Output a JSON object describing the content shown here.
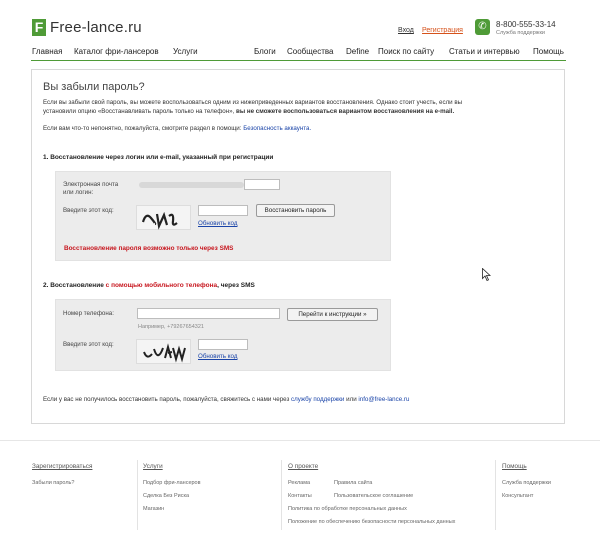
{
  "header": {
    "logo_letter": "F",
    "logo_text": "Free-lance.ru",
    "login": "Вход",
    "register": "Регистрация",
    "phone": "8-800-555-33-14",
    "phone_sub": "Служба поддержки"
  },
  "nav": {
    "left": [
      "Главная",
      "Каталог фри-лансеров",
      "Услуги"
    ],
    "right": [
      "Блоги",
      "Сообщества",
      "Define",
      "Поиск по сайту",
      "Статьи и интервью",
      "Помощь"
    ]
  },
  "page": {
    "title": "Вы забыли пароль?",
    "intro_line1": "Если вы забыли свой пароль, вы можете воспользоваться одним из нижеприведенных вариантов восстановления. Однако стоит учесть, если вы",
    "intro_line2_plain": "установили опцию «Восстанавливать пароль только на телефон»,",
    "intro_line2_bold": "вы не сможете воспользоваться вариантом восстановления на e-mail.",
    "help_text": "Если вам что-то непонятно, пожалуйста, смотрите раздел в помощи:",
    "help_link": "Безопасность аккаунта.",
    "step1": "1.  Восстановление через логин или e-mail, указанный при регистрации",
    "email_label_1": "Электронная почта",
    "email_label_2": "или логин:",
    "captcha_label": "Введите этот код:",
    "restore_button": "Восстановить пароль",
    "refresh_code": "Обновить код",
    "sms_warning": "Восстановление пароля возможно только через SMS",
    "step2_a": "2.  Восстановление",
    "step2_b": "с помощью мобильного телефона",
    "step2_c": ", через SMS",
    "phone_label": "Номер телефона:",
    "phone_hint": "Например, +79267654321",
    "instructions_button": "Перейти к инструкции »",
    "captcha_label_2": "Введите этот код:",
    "refresh_code_2": "Обновить код",
    "bottom_text": "Если у вас не получилось восстановить пароль, пожалуйста, свяжитесь с нами через",
    "support_link": "службу поддержки",
    "or_text": "или",
    "email_link": "info@free-lance.ru"
  },
  "footer": {
    "col1": {
      "title": "Зарегистрироваться",
      "items": [
        "Забыли пароль?"
      ]
    },
    "col2": {
      "title": "Услуги",
      "items": [
        "Подбор фри-лансеров",
        "Сделка Без Риска",
        "Магазин"
      ]
    },
    "col3": {
      "title": "О проекте",
      "items": [
        "Реклама",
        "Контакты",
        "Политика по обработке персональных данных",
        "Положение по обеспечению безопасности персональных данных"
      ]
    },
    "col3b": {
      "items": [
        "Правила сайта",
        "Пользовательское соглашение"
      ]
    },
    "col4": {
      "title": "Помощь",
      "items": [
        "Служба поддержки",
        "Консультант"
      ]
    }
  },
  "colors": {
    "brand_green": "#4f9b37",
    "warning_red": "#c7161e",
    "link_blue": "#1a44a8"
  },
  "icons": [
    "logo-f-icon",
    "phone-icon",
    "mouse-cursor-icon"
  ]
}
